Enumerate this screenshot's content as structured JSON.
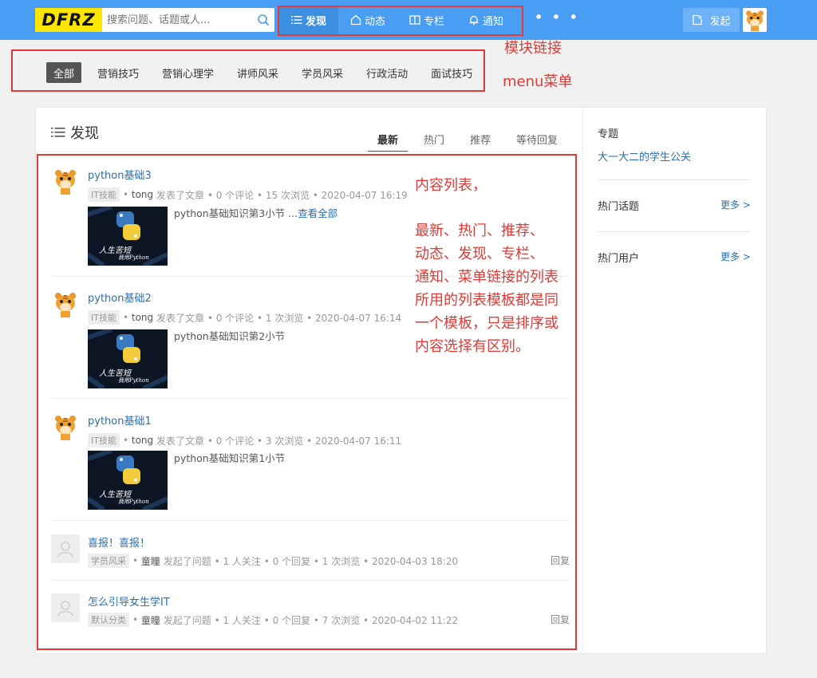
{
  "brand": {
    "logo_text": "DFRZ"
  },
  "search": {
    "placeholder": "搜索问题、话题或人..."
  },
  "nav": {
    "items": [
      {
        "label": "发现",
        "icon": "list-icon"
      },
      {
        "label": "动态",
        "icon": "home-icon"
      },
      {
        "label": "专栏",
        "icon": "book-icon"
      },
      {
        "label": "通知",
        "icon": "bell-icon"
      }
    ],
    "more": "• • •"
  },
  "header": {
    "publish_label": "发起"
  },
  "annotations": {
    "module_links": "模块链接",
    "menu": "menu菜单",
    "content_list": "内容列表，",
    "content_desc": [
      "最新、热门、推荐、",
      "动态、发现、专栏、",
      "通知、菜单链接的列表",
      "所用的列表模板都是同",
      "一个模板，只是排序或",
      "内容选择有区别。"
    ]
  },
  "menu": {
    "items": [
      "全部",
      "营销技巧",
      "营销心理学",
      "讲师风采",
      "学员风采",
      "行政活动",
      "面试技巧"
    ]
  },
  "main": {
    "title": "发现",
    "tabs": [
      "最新",
      "热门",
      "推荐",
      "等待回复"
    ]
  },
  "feed": [
    {
      "title": "python基础3",
      "tag": "IT技能",
      "author": "tong",
      "action": "发表了文章",
      "stats": "• 0 个评论 • 15 次浏览 • 2020-04-07 16:19",
      "excerpt": "python基础知识第3小节 ...",
      "read_more": "查看全部"
    },
    {
      "title": "python基础2",
      "tag": "IT技能",
      "author": "tong",
      "action": "发表了文章",
      "stats": "• 0 个评论 • 1 次浏览 • 2020-04-07 16:14",
      "excerpt": "python基础知识第2小节"
    },
    {
      "title": "python基础1",
      "tag": "IT技能",
      "author": "tong",
      "action": "发表了文章",
      "stats": "• 0 个评论 • 3 次浏览 • 2020-04-07 16:11",
      "excerpt": "python基础知识第1小节"
    },
    {
      "title": "喜报！喜报！",
      "tag": "学员风采",
      "author": "童瞳",
      "action": "发起了问题",
      "stats": "• 1 人关注 • 0 个回复 • 1 次浏览 • 2020-04-03 18:20",
      "reply": "回复"
    },
    {
      "title": "怎么引导女生学IT",
      "tag": "默认分类",
      "author": "童瞳",
      "action": "发起了问题",
      "stats": "• 1 人关注 • 0 个回复 • 7 次浏览 • 2020-04-02 11:22",
      "reply": "回复"
    }
  ],
  "thumb_caption": {
    "line1": "人生苦短",
    "line2": "我用Python"
  },
  "sidebar": {
    "topic_head": "专题",
    "topic_link": "大一大二的学生公关",
    "hot_topics": "热门话题",
    "hot_users": "热门用户",
    "more": "更多 >"
  },
  "colors": {
    "header": "#499ef3",
    "annotation": "#e53935",
    "link": "#2a6fb8"
  }
}
